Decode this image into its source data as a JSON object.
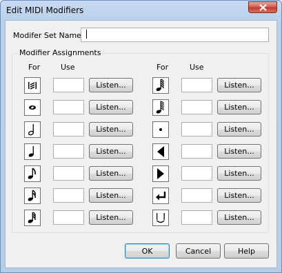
{
  "window": {
    "title": "Edit MIDI Modifiers"
  },
  "form": {
    "set_name_label": "Modifer Set Name:",
    "set_name_value": ""
  },
  "group": {
    "title": "Modifier Assignments",
    "col_for": "For",
    "col_use": "Use",
    "listen_label": "Listen...",
    "left_rows": [
      {
        "icon": "tremolo-measured-icon",
        "use": ""
      },
      {
        "icon": "whole-note-icon",
        "use": ""
      },
      {
        "icon": "half-note-icon",
        "use": ""
      },
      {
        "icon": "quarter-note-icon",
        "use": ""
      },
      {
        "icon": "eighth-note-icon",
        "use": ""
      },
      {
        "icon": "sixteenth-note-icon",
        "use": ""
      },
      {
        "icon": "thirty-second-note-icon",
        "use": ""
      }
    ],
    "right_rows": [
      {
        "icon": "sixty-fourth-note-icon",
        "use": ""
      },
      {
        "icon": "hundred-twenty-eighth-note-icon",
        "use": ""
      },
      {
        "icon": "staccato-dot-icon",
        "use": ""
      },
      {
        "icon": "decrescendo-icon",
        "use": ""
      },
      {
        "icon": "crescendo-icon",
        "use": ""
      },
      {
        "icon": "return-arrow-icon",
        "use": ""
      },
      {
        "icon": "tie-icon",
        "use": ""
      }
    ]
  },
  "buttons": {
    "ok": "OK",
    "cancel": "Cancel",
    "help": "Help"
  }
}
